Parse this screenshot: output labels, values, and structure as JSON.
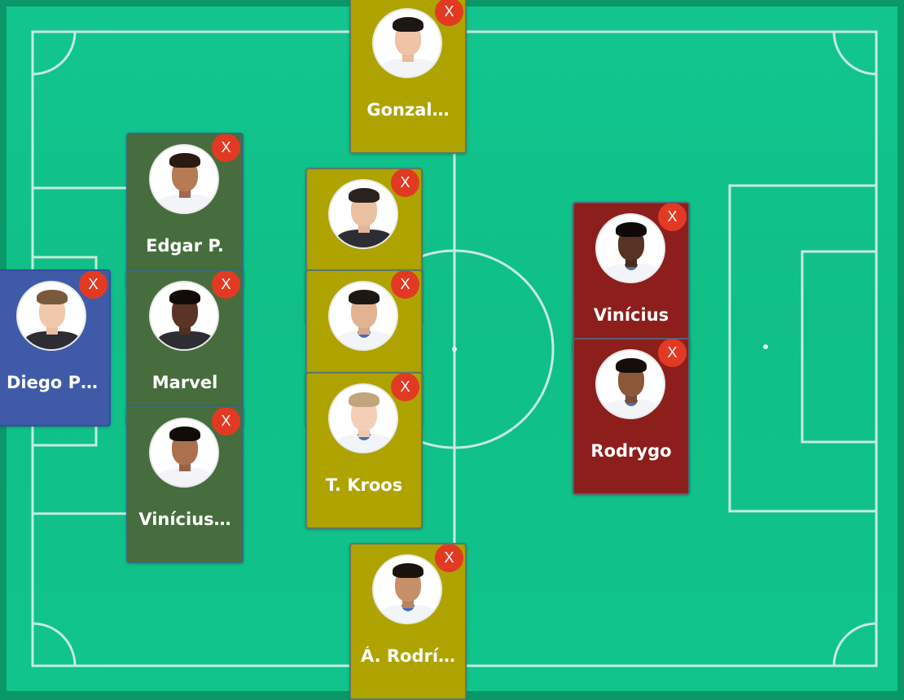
{
  "colors": {
    "pitch": "#10c48c",
    "goalkeeper": "#3f5ba8",
    "defender": "#476d3e",
    "midfielder": "#afa300",
    "forward": "#8c1f1c",
    "remove_button": "#e23a22"
  },
  "remove_label": "X",
  "players": [
    {
      "name": "Gonzal…",
      "role": "midfielder",
      "icon": "player-photo"
    },
    {
      "name": "Edgar P.",
      "role": "defender",
      "icon": "player-photo"
    },
    {
      "name": "Diego P…",
      "role": "goalkeeper",
      "icon": "player-photo"
    },
    {
      "name": "Marvel",
      "role": "defender",
      "icon": "player-photo"
    },
    {
      "name": "Vinícius…",
      "role": "defender",
      "icon": "player-photo"
    },
    {
      "name": "",
      "role": "midfielder",
      "icon": "player-photo"
    },
    {
      "name": "",
      "role": "midfielder",
      "icon": "player-photo"
    },
    {
      "name": "T. Kroos",
      "role": "midfielder",
      "icon": "player-photo"
    },
    {
      "name": "Á. Rodrí…",
      "role": "midfielder",
      "icon": "player-photo"
    },
    {
      "name": "Vinícius",
      "role": "forward",
      "icon": "player-photo"
    },
    {
      "name": "Rodrygo",
      "role": "forward",
      "icon": "player-photo"
    }
  ]
}
